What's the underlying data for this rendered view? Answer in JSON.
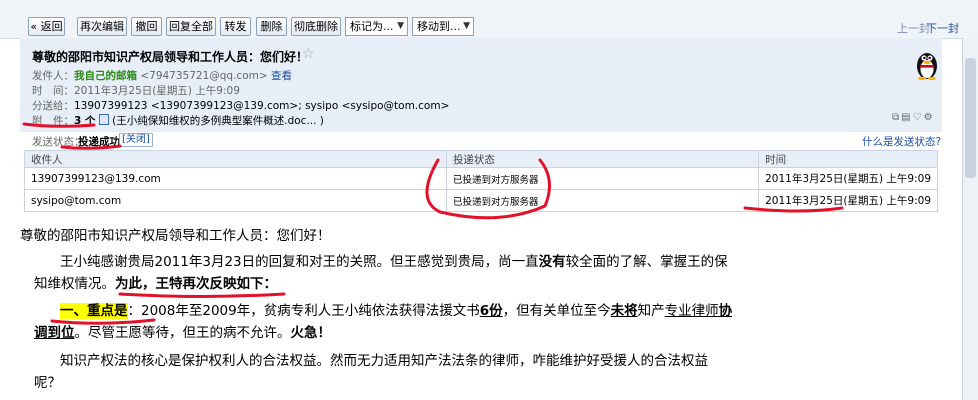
{
  "toolbar": {
    "back": "« 返回",
    "reedit": "再次编辑",
    "recall": "撤回",
    "reply_all": "回复全部",
    "forward": "转发",
    "delete": "删除",
    "delete_forever": "彻底删除",
    "mark_as": "标记为...",
    "move_to": "移动到...",
    "prev": "上一封",
    "next": "下一封"
  },
  "header": {
    "subject": "尊敬的邵阳市知识产权局领导和工作人员：您们好！",
    "from_label": "发件人：",
    "from_name": "我自己的邮箱",
    "from_addr": "<794735721@qq.com>",
    "from_view": "查看",
    "time_label": "时　间：",
    "time_value": "2011年3月25日(星期五) 上午9:09",
    "to_label": "分送给：",
    "to_value": "13907399123 <13907399123@139.com>; sysipo <sysipo@tom.com>",
    "attach_label": "附　件：",
    "attach_count": "3 个",
    "attach_value": "(王小纯保知维权的多例典型案件概述.doc... )"
  },
  "status": {
    "label": "发送状态：",
    "value": "投递成功",
    "close": "[关闭]",
    "what": "什么是发送状态?"
  },
  "table": {
    "headers": [
      "收件人",
      "投递状态",
      "时间"
    ],
    "rows": [
      [
        "13907399123@139.com",
        "已投递到对方服务器",
        "2011年3月25日(星期五) 上午9:09"
      ],
      [
        "sysipo@tom.com",
        "已投递到对方服务器",
        "2011年3月25日(星期五) 上午9:09"
      ]
    ]
  },
  "body": {
    "greeting": "尊敬的邵阳市知识产权局领导和工作人员：您们好！",
    "p1_a": "王小纯感谢贵局2011年3月23日的回复和对王的关照。但王感觉到贵局，尚一直",
    "p1_b": "没有",
    "p1_c": "较全面的了解、掌握王的保",
    "p1_d": "知维权情况。",
    "p1_e": "为此，王特再次反映如下：",
    "p2_a": "一、重点是",
    "p2_b": "：2008年至2009年，贫病专利人王小纯依法获得法援文书",
    "p2_c": "6份",
    "p2_d": "，但有关单位至今",
    "p2_e": "未将",
    "p2_f": "知产",
    "p2_g": "专业律师",
    "p2_h": "协",
    "p2_i": "调到位",
    "p2_j": "。尽管王愿等待，但王的病不允许。",
    "p2_k": "火急！",
    "p3_a": "知识产权法的核心是保护权利人的合法权益。然而无力适用知产法法条的律师，咋能维护好受援人的合法权益",
    "p3_b": "呢？"
  }
}
